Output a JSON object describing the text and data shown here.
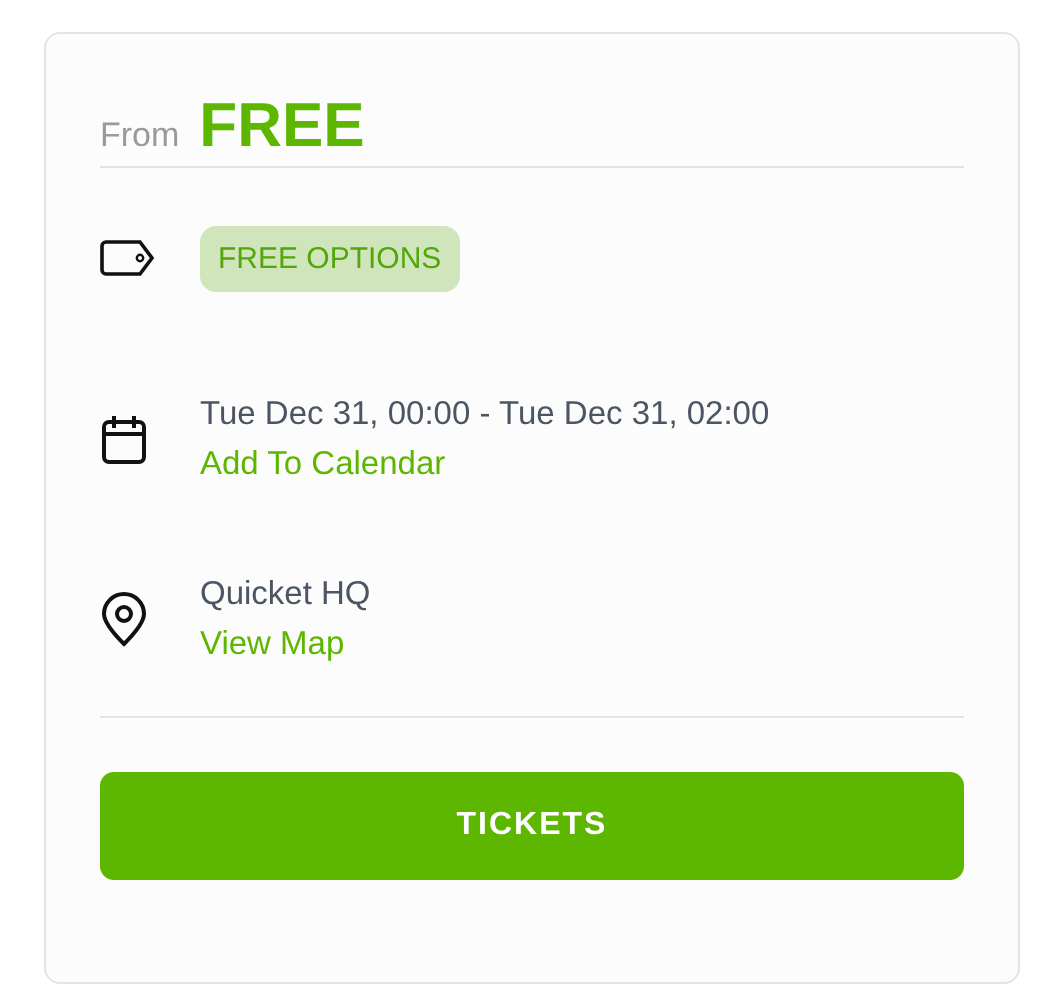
{
  "price": {
    "prefix": "From",
    "amount": "FREE"
  },
  "details": [
    {
      "kind": "tag",
      "badge": "FREE OPTIONS"
    },
    {
      "kind": "date",
      "text": "Tue Dec 31, 00:00 - Tue Dec 31, 02:00",
      "link": "Add To Calendar"
    },
    {
      "kind": "location",
      "text": "Quicket HQ",
      "link": "View Map"
    }
  ],
  "button": "TICKETS"
}
